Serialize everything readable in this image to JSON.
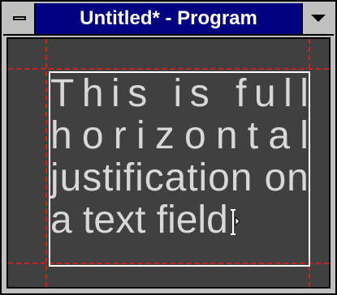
{
  "window": {
    "title": "Untitled* - Program"
  },
  "icons": {
    "system_menu": "system-menu-icon",
    "dropdown": "chevron-down-icon",
    "text_cursor": "i-beam-cursor-icon"
  },
  "colors": {
    "titlebar": "#000080",
    "canvas": "#404040",
    "guides": "#d02020",
    "field_border": "#ffffff",
    "text": "#d8d8d8"
  },
  "text_field": {
    "lines": [
      "This is full",
      "horizontal",
      "justification on",
      "a text field"
    ]
  }
}
